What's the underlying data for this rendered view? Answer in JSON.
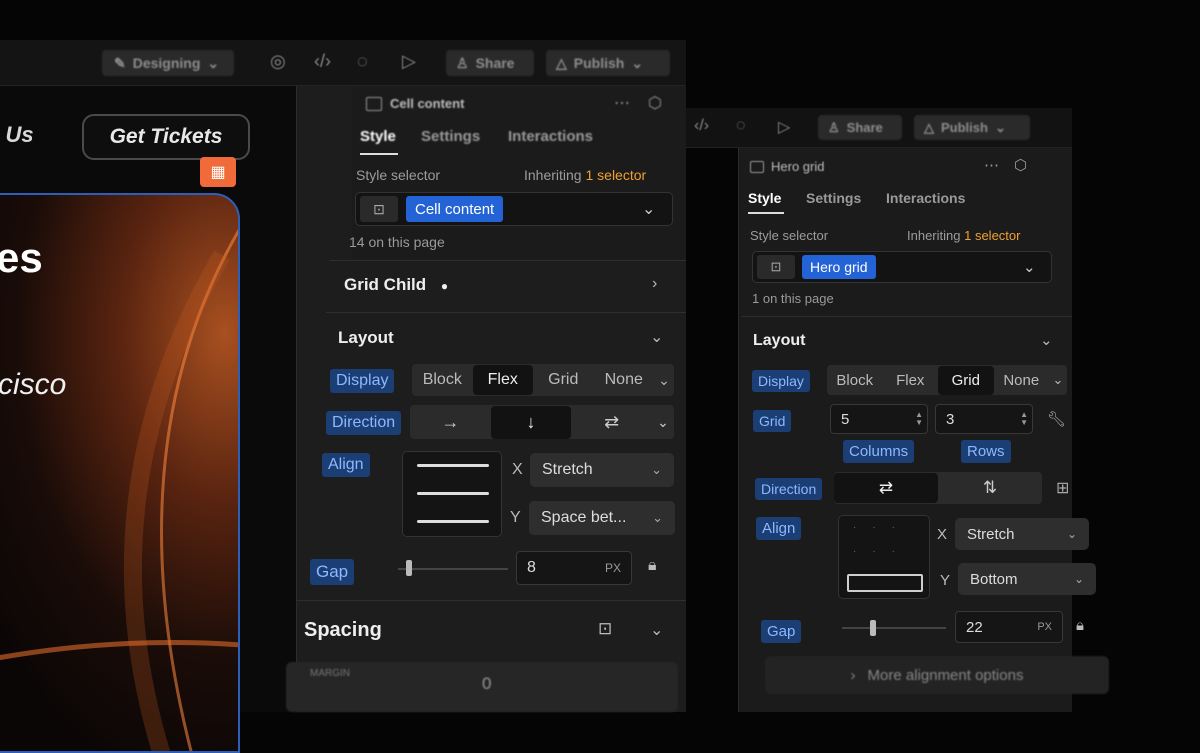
{
  "toolbar": {
    "mode_label": "Designing",
    "share_label": "Share",
    "publish_label": "Publish"
  },
  "canvas": {
    "nav_contact": "t Us",
    "nav_tickets": "Get Tickets",
    "hero_title_fragment": "es",
    "hero_city_fragment": "cisco"
  },
  "panel1": {
    "element_name": "Cell content",
    "tabs": [
      "Style",
      "Settings",
      "Interactions"
    ],
    "style_selector_label": "Style selector",
    "inheriting_text": "Inheriting",
    "selector_count": "1 selector",
    "class_tag": "Cell content",
    "page_count": "14 on this page",
    "grid_child_label": "Grid Child",
    "layout": {
      "title": "Layout",
      "display_label": "Display",
      "display_options": [
        "Block",
        "Flex",
        "Grid",
        "None"
      ],
      "display_selected": "Flex",
      "direction_label": "Direction",
      "align_label": "Align",
      "align_x_axis": "X",
      "align_x_value": "Stretch",
      "align_y_axis": "Y",
      "align_y_value": "Space bet...",
      "gap_label": "Gap",
      "gap_value": "8",
      "gap_unit": "PX"
    },
    "spacing": {
      "title": "Spacing",
      "margin_label": "MARGIN",
      "margin_value": "0"
    }
  },
  "panel2": {
    "element_name": "Hero grid",
    "tabs": [
      "Style",
      "Settings",
      "Interactions"
    ],
    "style_selector_label": "Style selector",
    "inheriting_text": "Inheriting",
    "selector_count": "1 selector",
    "class_tag": "Hero grid",
    "page_count": "1 on this page",
    "layout": {
      "title": "Layout",
      "display_label": "Display",
      "display_options": [
        "Block",
        "Flex",
        "Grid",
        "None"
      ],
      "display_selected": "Grid",
      "grid_label": "Grid",
      "columns_value": "5",
      "rows_value": "3",
      "columns_label": "Columns",
      "rows_label": "Rows",
      "direction_label": "Direction",
      "align_label": "Align",
      "align_x_axis": "X",
      "align_x_value": "Stretch",
      "align_y_axis": "Y",
      "align_y_value": "Bottom",
      "gap_label": "Gap",
      "gap_value": "22",
      "gap_unit": "PX",
      "more_options": "More alignment options"
    }
  },
  "colors": {
    "accent_blue": "#1b3e74",
    "selector_orange": "#f0a030",
    "badge_orange": "#f06a3a"
  }
}
